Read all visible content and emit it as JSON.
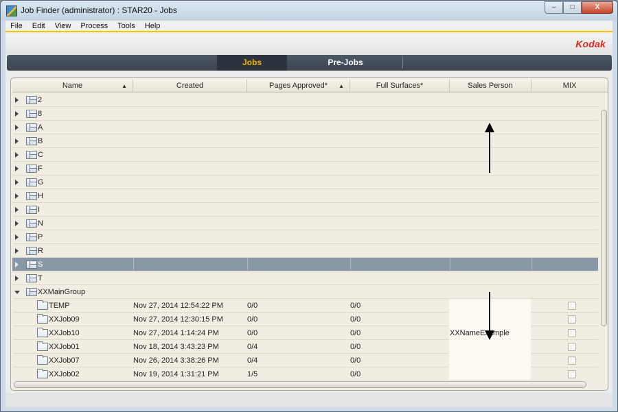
{
  "window": {
    "title": "Job Finder (administrator) : STAR20 - Jobs",
    "min_label": "–",
    "max_label": "□",
    "close_label": "X"
  },
  "menu": [
    "File",
    "Edit",
    "View",
    "Process",
    "Tools",
    "Help"
  ],
  "brand": "Kodak",
  "tabs": {
    "active": "Jobs",
    "inactive": "Pre-Jobs"
  },
  "columns": [
    {
      "label": "Name",
      "sort": "▲"
    },
    {
      "label": "Created",
      "sort": ""
    },
    {
      "label": "Pages Approved*",
      "sort": "▲"
    },
    {
      "label": "Full Surfaces*",
      "sort": ""
    },
    {
      "label": "Sales Person",
      "sort": ""
    },
    {
      "label": "MIX",
      "sort": ""
    }
  ],
  "groups": [
    {
      "name": "2",
      "expanded": false,
      "selected": false
    },
    {
      "name": "8",
      "expanded": false,
      "selected": false
    },
    {
      "name": "A",
      "expanded": false,
      "selected": false
    },
    {
      "name": "B",
      "expanded": false,
      "selected": false
    },
    {
      "name": "C",
      "expanded": false,
      "selected": false
    },
    {
      "name": "F",
      "expanded": false,
      "selected": false
    },
    {
      "name": "G",
      "expanded": false,
      "selected": false
    },
    {
      "name": "H",
      "expanded": false,
      "selected": false
    },
    {
      "name": "I",
      "expanded": false,
      "selected": false
    },
    {
      "name": "N",
      "expanded": false,
      "selected": false
    },
    {
      "name": "P",
      "expanded": false,
      "selected": false
    },
    {
      "name": "R",
      "expanded": false,
      "selected": false
    },
    {
      "name": "S",
      "expanded": false,
      "selected": true
    },
    {
      "name": "T",
      "expanded": false,
      "selected": false
    },
    {
      "name": "XXMainGroup",
      "expanded": true,
      "selected": false
    }
  ],
  "jobs": [
    {
      "name": "TEMP",
      "created": "Nov 27, 2014 12:54:22 PM",
      "pages_approved": "0/0",
      "full_surfaces": "0/0",
      "sales_person": "",
      "mix": false
    },
    {
      "name": "XXJob09",
      "created": "Nov 27, 2014 12:30:15 PM",
      "pages_approved": "0/0",
      "full_surfaces": "0/0",
      "sales_person": "",
      "mix": false
    },
    {
      "name": "XXJob10",
      "created": "Nov 27, 2014 1:14:24 PM",
      "pages_approved": "0/0",
      "full_surfaces": "0/0",
      "sales_person": "XXNameExample",
      "mix": false
    },
    {
      "name": "XXJob01",
      "created": "Nov 18, 2014 3:43:23 PM",
      "pages_approved": "0/4",
      "full_surfaces": "0/0",
      "sales_person": "",
      "mix": false
    },
    {
      "name": "XXJob07",
      "created": "Nov 26, 2014 3:38:26 PM",
      "pages_approved": "0/4",
      "full_surfaces": "0/0",
      "sales_person": "",
      "mix": false
    },
    {
      "name": "XXJob02",
      "created": "Nov 19, 2014 1:31:21 PM",
      "pages_approved": "1/5",
      "full_surfaces": "0/0",
      "sales_person": "",
      "mix": false
    }
  ],
  "colors": {
    "accent": "#f0b400",
    "brand": "#e2261b",
    "selection": "#8a97a6",
    "tabbar": "#3a434e"
  }
}
